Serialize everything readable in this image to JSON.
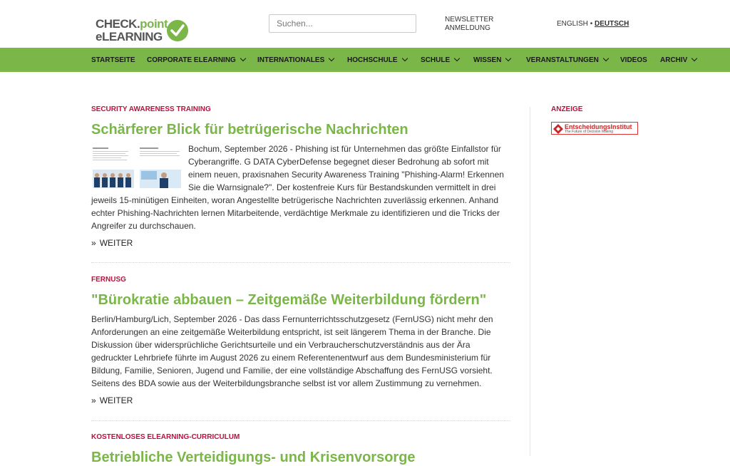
{
  "header": {
    "logo_line1_a": "CHECK.",
    "logo_line1_b": "point",
    "logo_line2": "eLEARNING",
    "search_placeholder": "Suchen...",
    "newsletter_label": "NEWSLETTER ANMELDUNG",
    "lang_english": "ENGLISH",
    "lang_separator": "•",
    "lang_deutsch": "DEUTSCH"
  },
  "nav": {
    "items": [
      {
        "label": "STARTSEITE"
      },
      {
        "label": "CORPORATE ELEARNING"
      },
      {
        "label": "INTERNATIONALES"
      },
      {
        "label": "HOCHSCHULE"
      },
      {
        "label": "SCHULE"
      },
      {
        "label": "WISSEN"
      },
      {
        "label": "VERANSTALTUNGEN"
      },
      {
        "label": "VIDEOS"
      },
      {
        "label": "ARCHIV"
      }
    ]
  },
  "articles": [
    {
      "category": "SECURITY AWARENESS TRAINING",
      "title": "Schärferer Blick für betrügerische Nachrichten",
      "text": "Bochum, September 2026 - Phishing ist für Unternehmen das größte Einfallstor für Cyberangriffe. G DATA CyberDefense begegnet dieser Bedrohung ab sofort mit einem neuen, praxisnahen Security Awareness Training \"Phishing-Alarm! Erkennen Sie die Warnsignale?\". Der kostenfreie Kurs für Bestandskunden vermittelt in drei jeweils 15-minütigen Einheiten, woran Angestellte betrügerische Nachrichten zuverlässig erkennen. Anhand echter Phishing-Nachrichten lernen Mitarbeitende, verdächtige Merkmale zu identifizieren und die Tricks der Angreifer zu durchschauen.",
      "more": "WEITER"
    },
    {
      "category": "FERNUSG",
      "title": "\"Bürokratie abbauen – Zeitgemäße Weiterbildung fördern\"",
      "text": "Berlin/Hamburg/Lich, September 2026 - Das dass Fernunterrichtsschutzgesetz (FernUSG) nicht mehr den Anforderungen an eine zeitgemäße Weiterbildung entspricht, ist seit längerem Thema in der Branche. Die Diskussion über widersprüchliche Gerichtsurteile und ein Verbraucherschutzverständnis aus der Ära gedruckter Lehrbriefe führte im August 2026 zu einem Referentenentwurf aus dem Bundesministerium für Bildung, Familie, Senioren, Jugend und Familie, der eine vollständige Abschaffung des FernUSG vorsieht. Seitens des BDA sowie aus der Weiterbildungsbranche selbst ist vor allem Zustimmung zu vernehmen.",
      "more": "WEITER"
    },
    {
      "category": "KOSTENLOSES ELEARNING-CURRICULUM",
      "title": "Betriebliche Verteidigungs- und Krisenvorsorge"
    }
  ],
  "sidebar": {
    "label": "ANZEIGE",
    "ad_title": "EntscheidungsInstitut",
    "ad_subtitle": "The Future of Decision Making"
  },
  "colors": {
    "accent_green": "#7ab648",
    "category_red": "#b8123e"
  }
}
